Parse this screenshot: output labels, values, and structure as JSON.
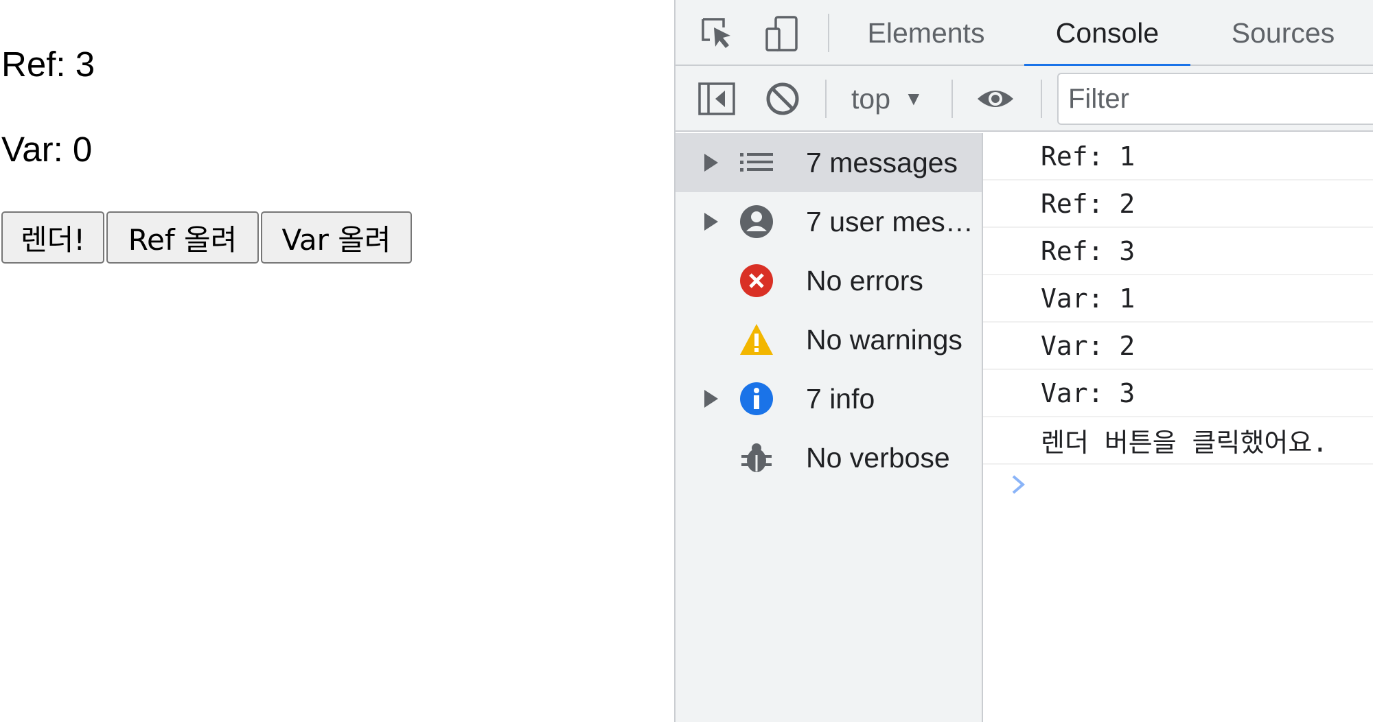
{
  "page": {
    "ref_text": "Ref: 3",
    "var_text": "Var: 0",
    "buttons": {
      "render": "렌더!",
      "ref_up": "Ref 올려",
      "var_up": "Var 올려"
    }
  },
  "devtools": {
    "tabs": {
      "elements": "Elements",
      "console": "Console",
      "sources": "Sources"
    },
    "toolbar": {
      "context": "top",
      "filter_placeholder": "Filter"
    },
    "sidebar": {
      "messages": "7 messages",
      "user_messages": "7 user messages",
      "errors": "No errors",
      "warnings": "No warnings",
      "info": "7 info",
      "verbose": "No verbose"
    },
    "console_lines": [
      "Ref: 1",
      "Ref: 2",
      "Ref: 3",
      "Var: 1",
      "Var: 2",
      "Var: 3",
      "렌더 버튼을 클릭했어요."
    ]
  },
  "colors": {
    "active_tab_underline": "#1a73e8",
    "error": "#d93025",
    "warning": "#f2b600",
    "info": "#1a73e8",
    "icon_gray": "#5f6368",
    "prompt": "#8ab4f8"
  },
  "icons": {
    "inspect": "inspect-element-icon",
    "device": "device-toggle-icon",
    "sidebar_toggle": "sidebar-toggle-icon",
    "clear": "clear-console-icon",
    "eye": "live-expression-eye-icon",
    "messages": "list-icon",
    "user": "user-icon",
    "error": "error-icon",
    "warning": "warning-icon",
    "info": "info-icon",
    "verbose": "bug-icon"
  }
}
